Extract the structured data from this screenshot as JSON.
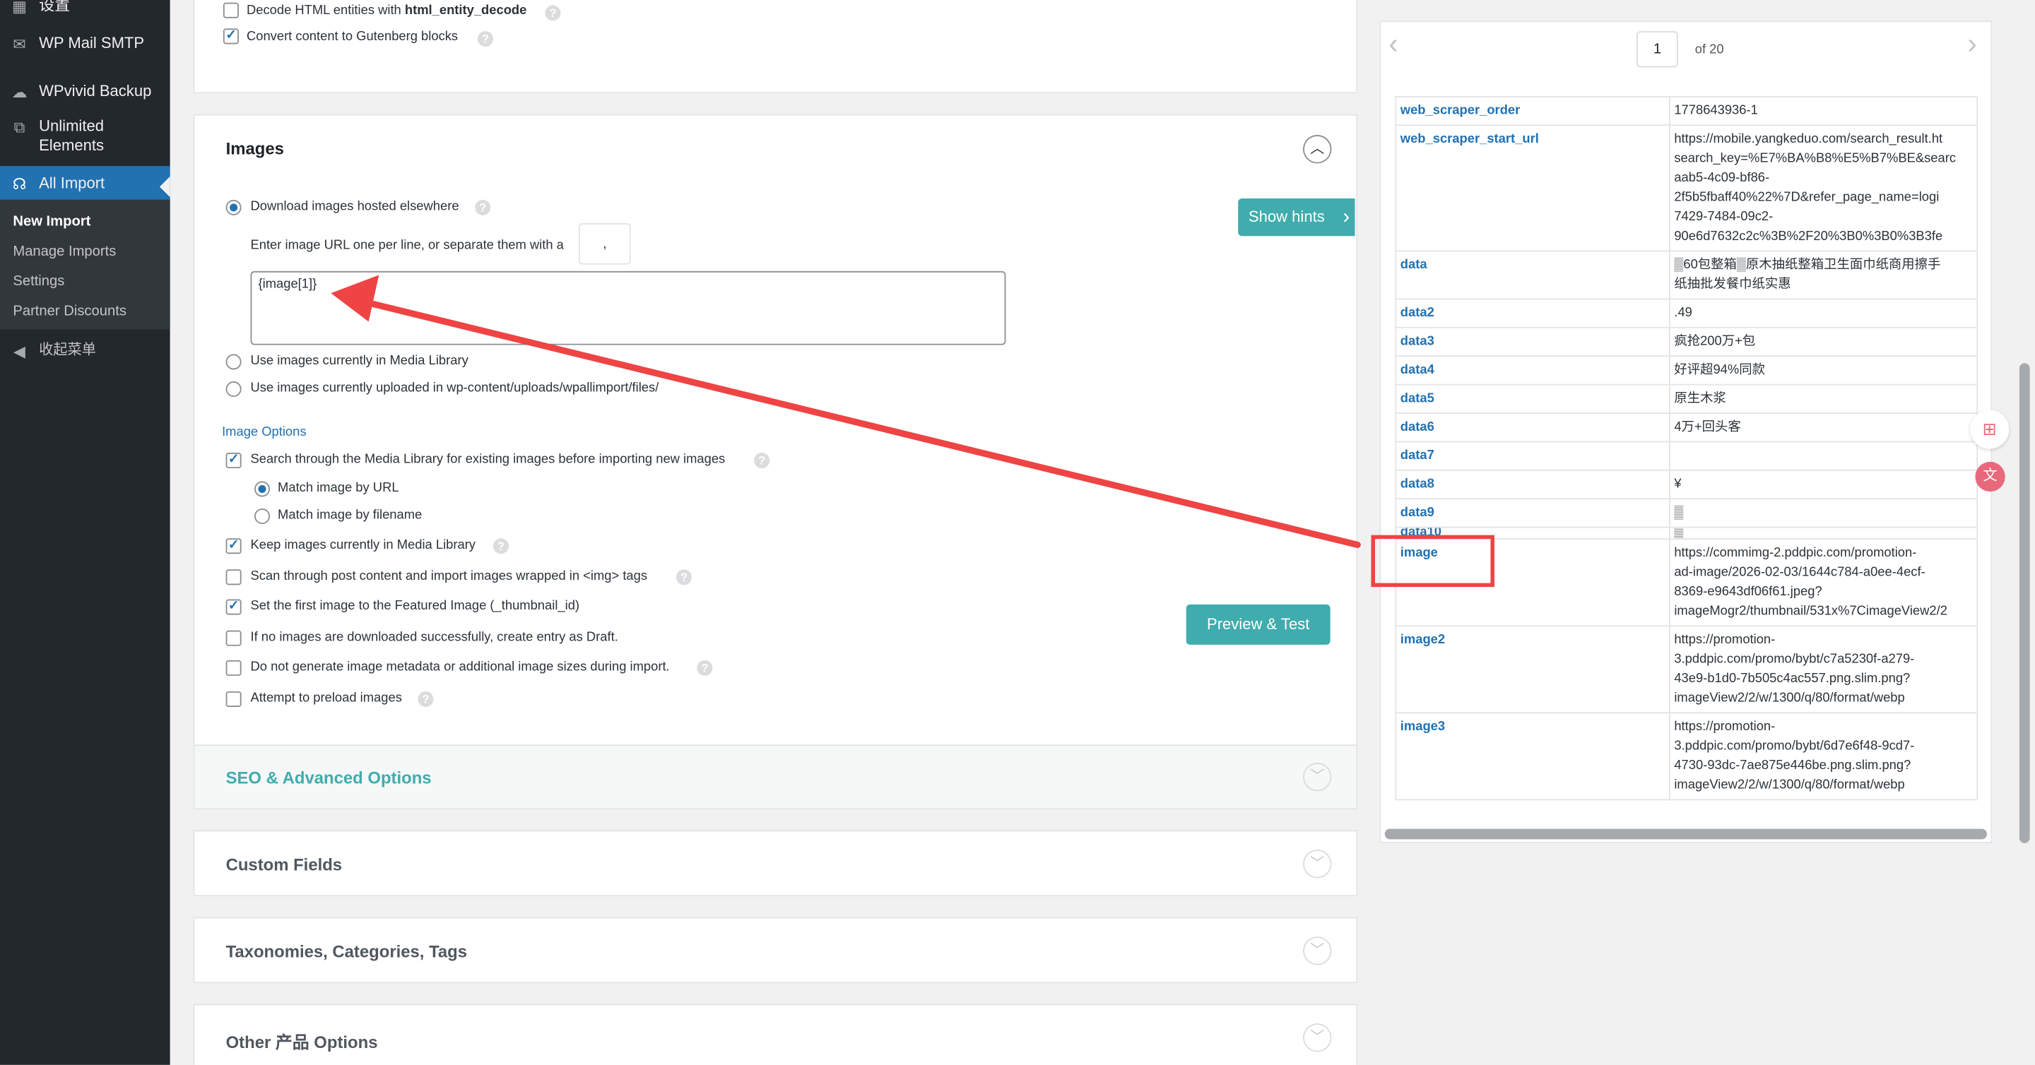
{
  "sidebar": {
    "items": [
      {
        "label": "设置",
        "icon": "settings-icon"
      },
      {
        "label": "WP Mail SMTP",
        "icon": "mail-icon"
      },
      {
        "label": "WPvivid Backup",
        "icon": "cloud-icon"
      },
      {
        "label": "Unlimited Elements",
        "icon": "unlimited-elements-icon"
      },
      {
        "label": "All Import",
        "icon": "all-import-icon"
      }
    ],
    "submenu": [
      "New Import",
      "Manage Imports",
      "Settings",
      "Partner Discounts"
    ],
    "collapse_label": "收起菜单"
  },
  "top_options": {
    "decode_prefix": "Decode HTML entities with ",
    "decode_func": "html_entity_decode",
    "gutenberg": "Convert content to Gutenberg blocks"
  },
  "images_panel": {
    "title": "Images",
    "download_label": "Download images hosted elsewhere",
    "separator_hint": "Enter image URL one per line, or separate them with a",
    "separator_value": ",",
    "image_field_value": "{image[1]}",
    "use_media_library": "Use images currently in Media Library",
    "use_uploaded": "Use images currently uploaded in wp-content/uploads/wpallimport/files/",
    "options_title": "Image Options",
    "search_media": "Search through the Media Library for existing images before importing new images",
    "match_url": "Match image by URL",
    "match_filename": "Match image by filename",
    "keep_images": "Keep images currently in Media Library",
    "scan_content": "Scan through post content and import images wrapped in <img> tags",
    "set_featured": "Set the first image to the Featured Image (_thumbnail_id)",
    "draft_if_none": "If no images are downloaded successfully, create entry as Draft.",
    "no_metadata": "Do not generate image metadata or additional image sizes during import.",
    "preload": "Attempt to preload images",
    "show_hints": "Show hints",
    "preview_test": "Preview & Test"
  },
  "sections": {
    "seo": "SEO & Advanced Options",
    "custom_fields": "Custom Fields",
    "taxonomies": "Taxonomies, Categories, Tags",
    "other": "Other 产品 Options"
  },
  "preview": {
    "page": "1",
    "of_label": "of 20",
    "rows": [
      {
        "key": "web_scraper_order",
        "value": "1778643936-1"
      },
      {
        "key": "web_scraper_start_url",
        "value": "https://mobile.yangkeduo.com/search_result.ht\nsearch_key=%E7%BA%B8%E5%B7%BE&searc\naab5-4c09-bf86-\n2f5b5fbaff40%22%7D&refer_page_name=logi\n7429-7484-09c2-\n90e6d7632c2c%3B%2F20%3B0%3B0%3B3fe"
      },
      {
        "key": "data",
        "value": "▒60包整箱▒原木抽纸整箱卫生面巾纸商用擦手\n纸抽批发餐巾纸实惠"
      },
      {
        "key": "data2",
        "value": ".49"
      },
      {
        "key": "data3",
        "value": "疯抢200万+包"
      },
      {
        "key": "data4",
        "value": "好评超94%同款"
      },
      {
        "key": "data5",
        "value": "原生木浆"
      },
      {
        "key": "data6",
        "value": "4万+回头客"
      },
      {
        "key": "data7",
        "value": ""
      },
      {
        "key": "data8",
        "value": "¥"
      },
      {
        "key": "data9",
        "value": "▒"
      },
      {
        "key": "data10",
        "value": "▒"
      },
      {
        "key": "image",
        "value": "https://commimg-2.pddpic.com/promotion-\nad-image/2026-02-03/1644c784-a0ee-4ecf-\n8369-e9643df06f61.jpeg?\nimageMogr2/thumbnail/531x%7CimageView2/2"
      },
      {
        "key": "image2",
        "value": "https://promotion-\n3.pddpic.com/promo/bybt/c7a5230f-a279-\n43e9-b1d0-7b505c4ac557.png.slim.png?\nimageView2/2/w/1300/q/80/format/webp"
      },
      {
        "key": "image3",
        "value": "https://promotion-\n3.pddpic.com/promo/bybt/6d7e6f48-9cd7-\n4730-93dc-7ae875e446be.png.slim.png?\nimageView2/2/w/1300/q/80/format/webp"
      }
    ]
  },
  "colors": {
    "sidebar_bg": "#23282d",
    "accent_blue": "#2271b1",
    "teal": "#40acad",
    "annotation_red": "#ee4444"
  }
}
